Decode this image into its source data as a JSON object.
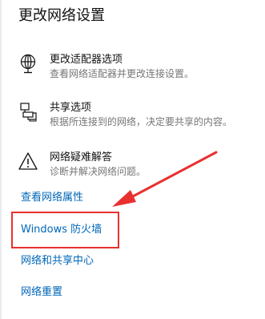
{
  "page": {
    "title": "更改网络设置"
  },
  "options": [
    {
      "title": "更改适配器选项",
      "desc": "查看网络适配器并更改连接设置。",
      "icon": "globe-monitor-icon"
    },
    {
      "title": "共享选项",
      "desc": "根据所连接到的网络，决定要共享的内容。",
      "icon": "sharing-icon"
    },
    {
      "title": "网络疑难解答",
      "desc": "诊断并解决网络问题。",
      "icon": "warning-icon"
    }
  ],
  "links": {
    "view_properties": "查看网络属性",
    "windows_firewall": "Windows 防火墙",
    "sharing_center": "网络和共享中心",
    "network_reset": "网络重置"
  },
  "colors": {
    "link": "#0067b8",
    "annotation": "#e8312f",
    "description": "#767676"
  }
}
